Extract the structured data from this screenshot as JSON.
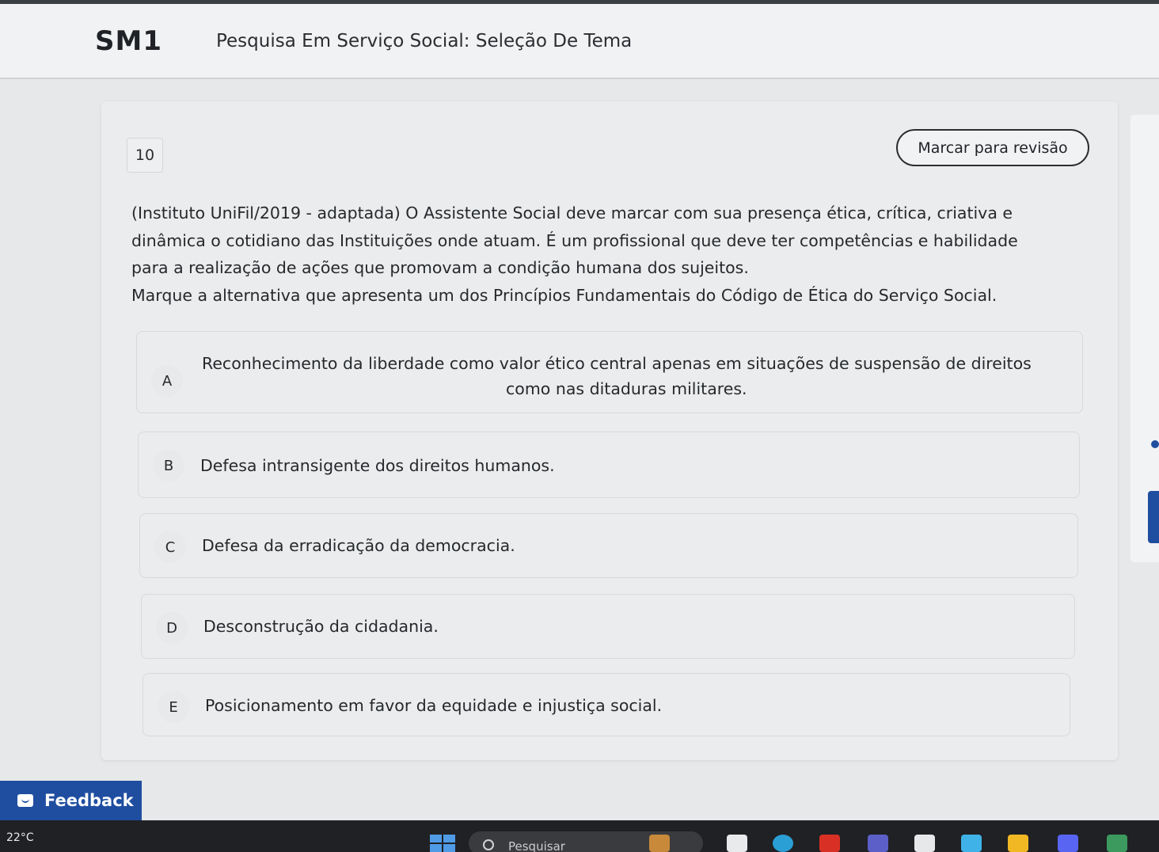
{
  "header": {
    "course_code": "SM1",
    "course_title": "Pesquisa Em Serviço Social: Seleção De Tema"
  },
  "question": {
    "number": "10",
    "review_button": "Marcar para revisão",
    "statement_lines": [
      "(Instituto UniFil/2019 - adaptada) O Assistente Social deve marcar com sua presença ética, crítica, criativa e",
      "dinâmica o cotidiano das Instituições onde atuam. É um profissional que deve ter competências e habilidade",
      "para a realização de ações que promovam a condição humana dos sujeitos.",
      "Marque a alternativa que apresenta um dos Princípios Fundamentais do Código de Ética do Serviço Social."
    ],
    "options": [
      {
        "letter": "A",
        "text_lines": [
          "Reconhecimento da liberdade como valor ético central apenas em situações de suspensão de direitos",
          "como nas ditaduras militares."
        ]
      },
      {
        "letter": "B",
        "text": "Defesa intransigente dos direitos humanos."
      },
      {
        "letter": "C",
        "text": "Defesa da erradicação da democracia."
      },
      {
        "letter": "D",
        "text": "Desconstrução da cidadania."
      },
      {
        "letter": "E",
        "text": "Posicionamento em favor da equidade e injustiça social."
      }
    ]
  },
  "feedback": {
    "label": "Feedback",
    "icon": "feedback-icon"
  },
  "taskbar": {
    "temperature": "22°C",
    "search_placeholder": "Pesquisar",
    "icons": [
      "windows-start-icon",
      "search-icon",
      "widgets-icon",
      "file-explorer-icon",
      "edge-icon",
      "gmail-icon",
      "teams-icon",
      "store-icon",
      "copilot-icon",
      "folder-icon",
      "discord-icon",
      "notification-app-icon"
    ]
  },
  "colors": {
    "accent": "#1f4ea0",
    "background": "#e6e8e9",
    "card": "#ebeced",
    "taskbar": "#202124"
  }
}
